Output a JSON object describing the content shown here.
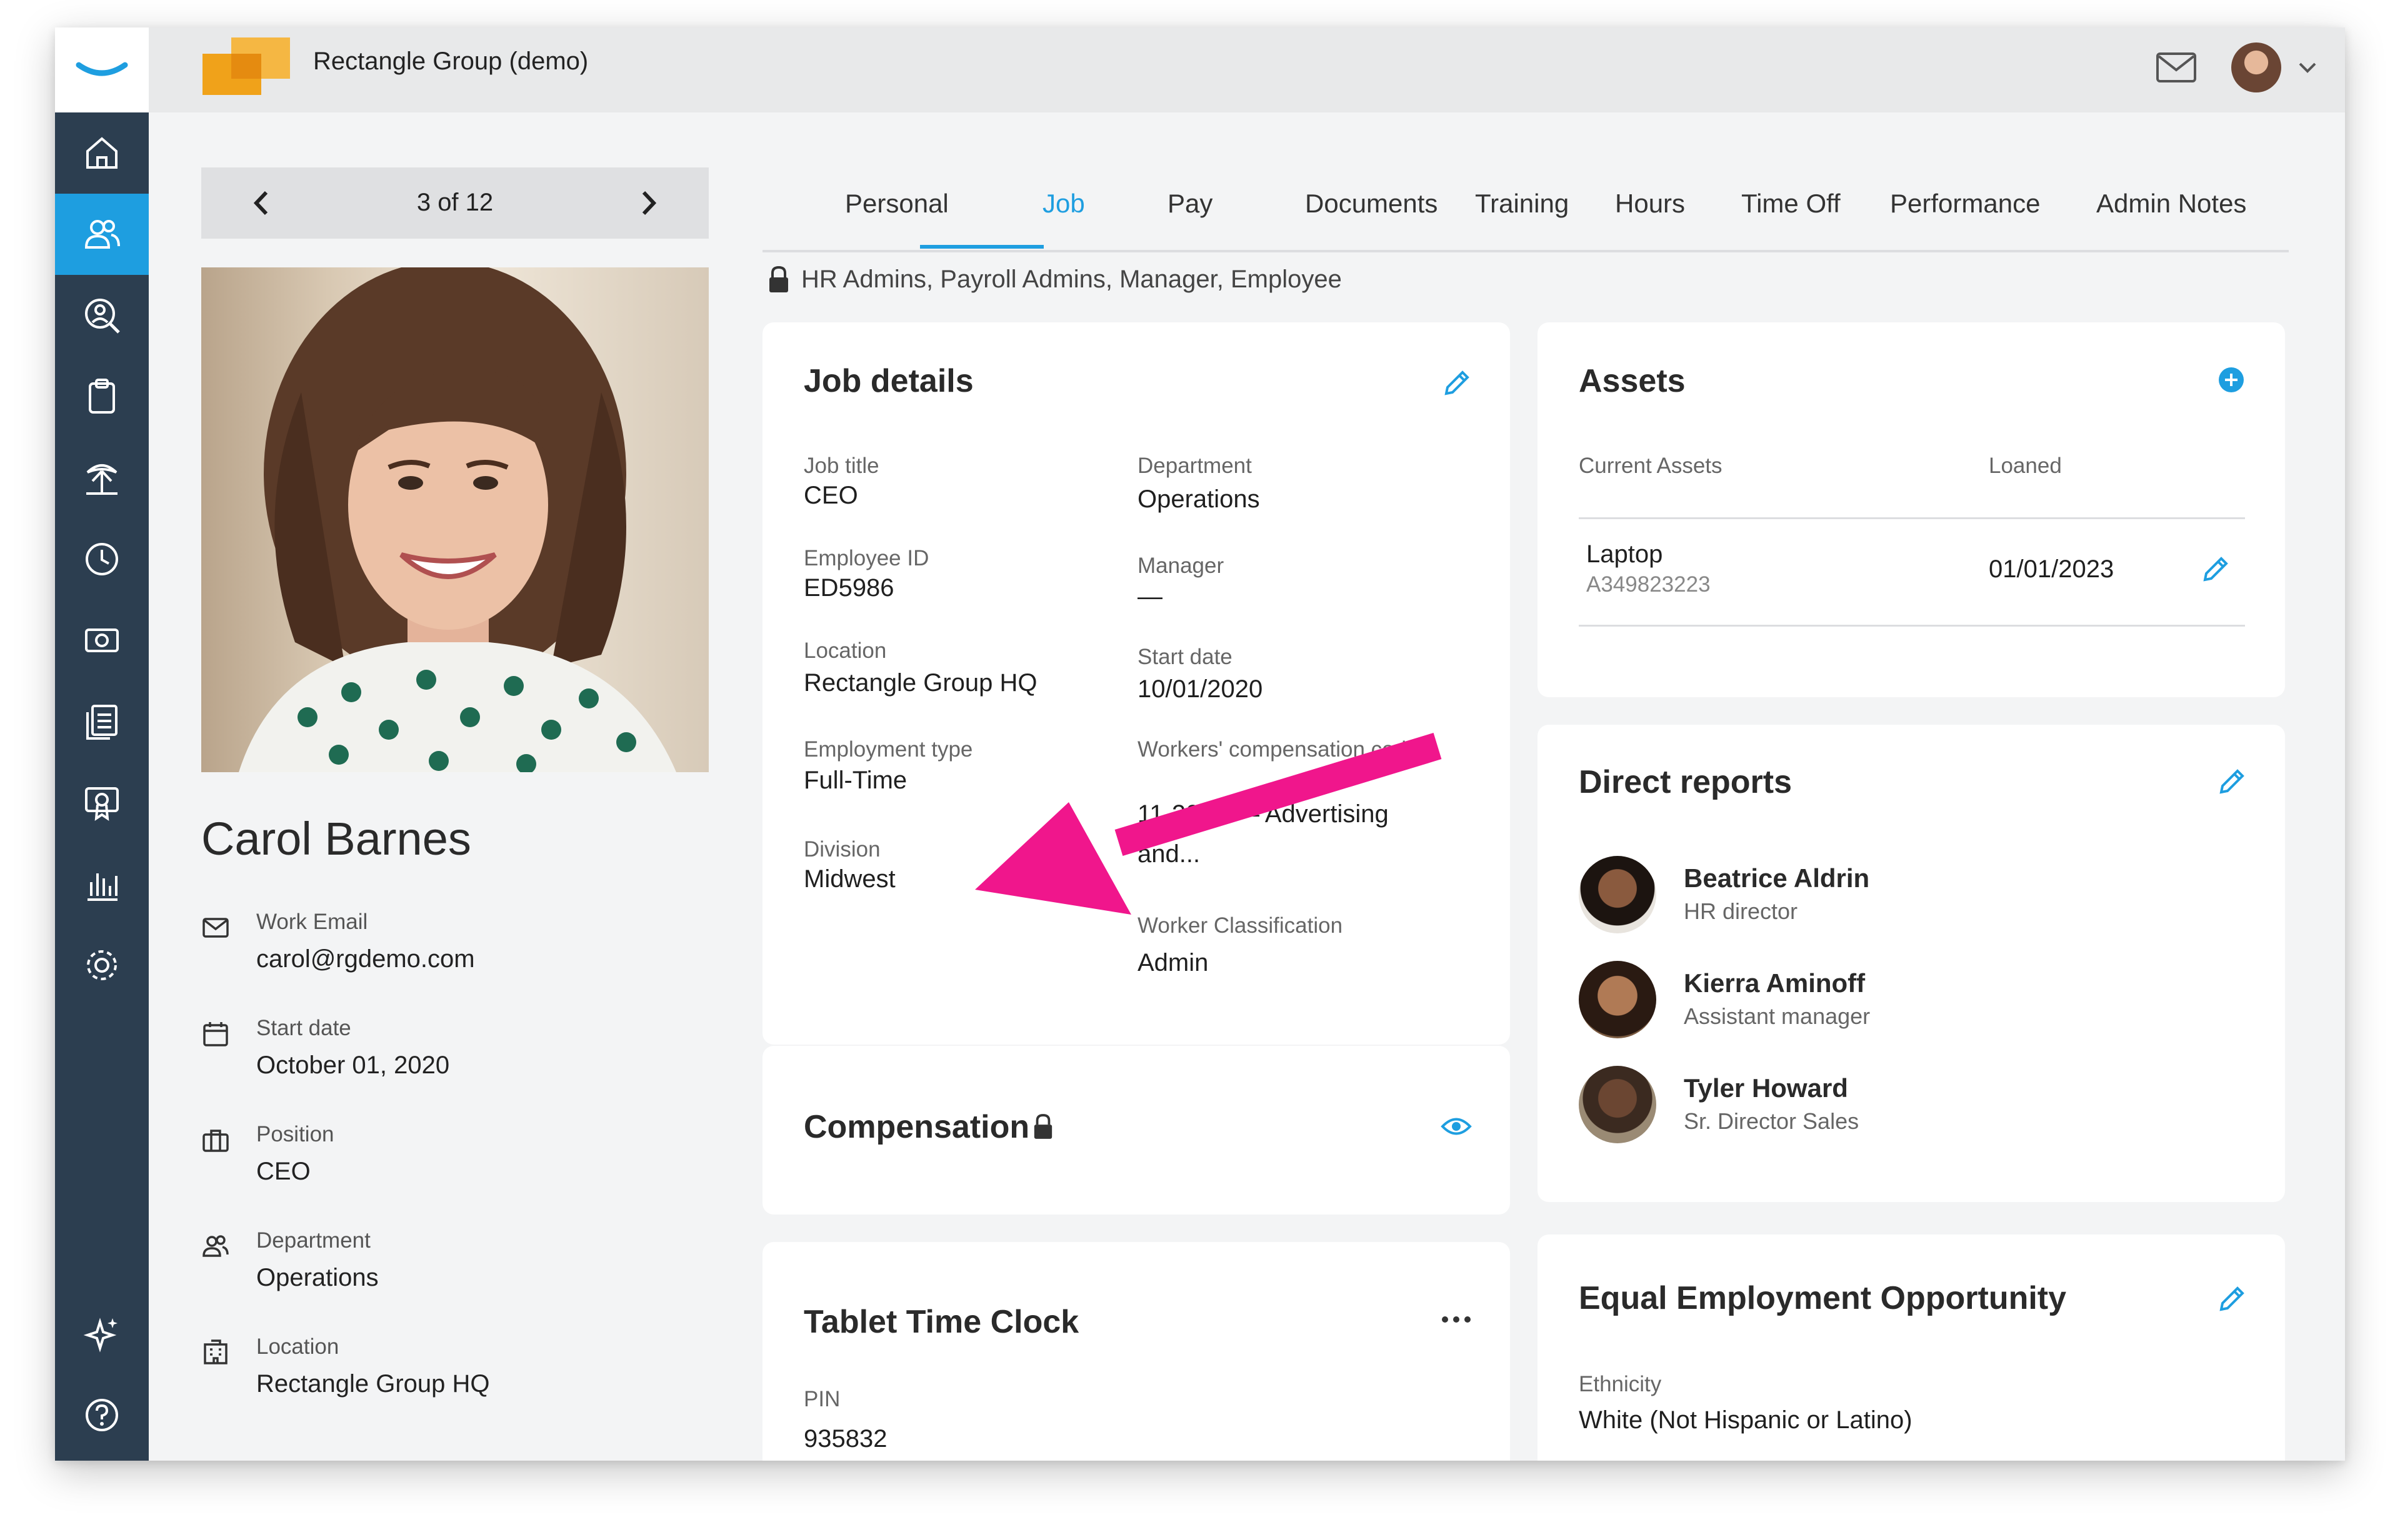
{
  "header": {
    "company": "Rectangle Group (demo)",
    "mail_icon": "mail-icon",
    "avatar": "user-avatar"
  },
  "colors": {
    "accent": "#1e9ee0",
    "sidebar": "#2c3e50",
    "annotation_arrow": "#f0168c",
    "company_logo": "#f0a21a"
  },
  "sidebar": {
    "items": [
      "home-icon",
      "people-icon",
      "people-search-icon",
      "clipboard-icon",
      "palm-tree-icon",
      "clock-icon",
      "money-icon",
      "documents-icon",
      "certificate-icon",
      "reports-icon",
      "gear-icon",
      "sparkle-icon",
      "help-icon"
    ],
    "active": "people-icon"
  },
  "pager": {
    "count": "3 of 12"
  },
  "profile": {
    "name": "Carol Barnes",
    "fields": [
      {
        "label": "Work Email",
        "value": "carol@rgdemo.com",
        "icon": "mail-icon"
      },
      {
        "label": "Start date",
        "value": "October 01, 2020",
        "icon": "calendar-icon"
      },
      {
        "label": "Position",
        "value": "CEO",
        "icon": "briefcase-icon"
      },
      {
        "label": "Department",
        "value": "Operations",
        "icon": "people-icon"
      },
      {
        "label": "Location",
        "value": "Rectangle Group HQ",
        "icon": "building-icon"
      }
    ]
  },
  "tabs": [
    "Personal",
    "Job",
    "Pay",
    "Documents",
    "Training",
    "Hours",
    "Time Off",
    "Performance",
    "Admin Notes"
  ],
  "active_tab": "Job",
  "permissions": "HR Admins, Payroll Admins, Manager, Employee",
  "job_details": {
    "title": "Job details",
    "left": [
      {
        "label": "Job title",
        "value": "CEO"
      },
      {
        "label": "Employee ID",
        "value": "ED5986"
      },
      {
        "label": "Location",
        "value": "Rectangle Group HQ"
      },
      {
        "label": "Employment type",
        "value": "Full-Time"
      },
      {
        "label": "Division",
        "value": "Midwest"
      }
    ],
    "right": [
      {
        "label": "Department",
        "value": "Operations"
      },
      {
        "label": "Manager",
        "value": "—"
      },
      {
        "label": "Start date",
        "value": "10/01/2020"
      },
      {
        "label": "Workers' compensation code",
        "value": "11-2010 — Advertising",
        "value2": "and..."
      },
      {
        "label": "Worker Classification",
        "value": "Admin"
      }
    ]
  },
  "compensation": {
    "title": "Compensation"
  },
  "tablet_time_clock": {
    "title": "Tablet Time Clock",
    "pin_label": "PIN",
    "pin": "935832"
  },
  "assets": {
    "title": "Assets",
    "col_current": "Current Assets",
    "col_loaned": "Loaned",
    "rows": [
      {
        "name": "Laptop",
        "id": "A349823223",
        "loaned": "01/01/2023"
      }
    ]
  },
  "direct_reports": {
    "title": "Direct reports",
    "people": [
      {
        "name": "Beatrice Aldrin",
        "role": "HR director"
      },
      {
        "name": "Kierra Aminoff",
        "role": "Assistant manager"
      },
      {
        "name": "Tyler Howard",
        "role": "Sr. Director Sales"
      }
    ]
  },
  "eeo": {
    "title": "Equal Employment Opportunity",
    "label": "Ethnicity",
    "value": "White (Not Hispanic or Latino)"
  }
}
